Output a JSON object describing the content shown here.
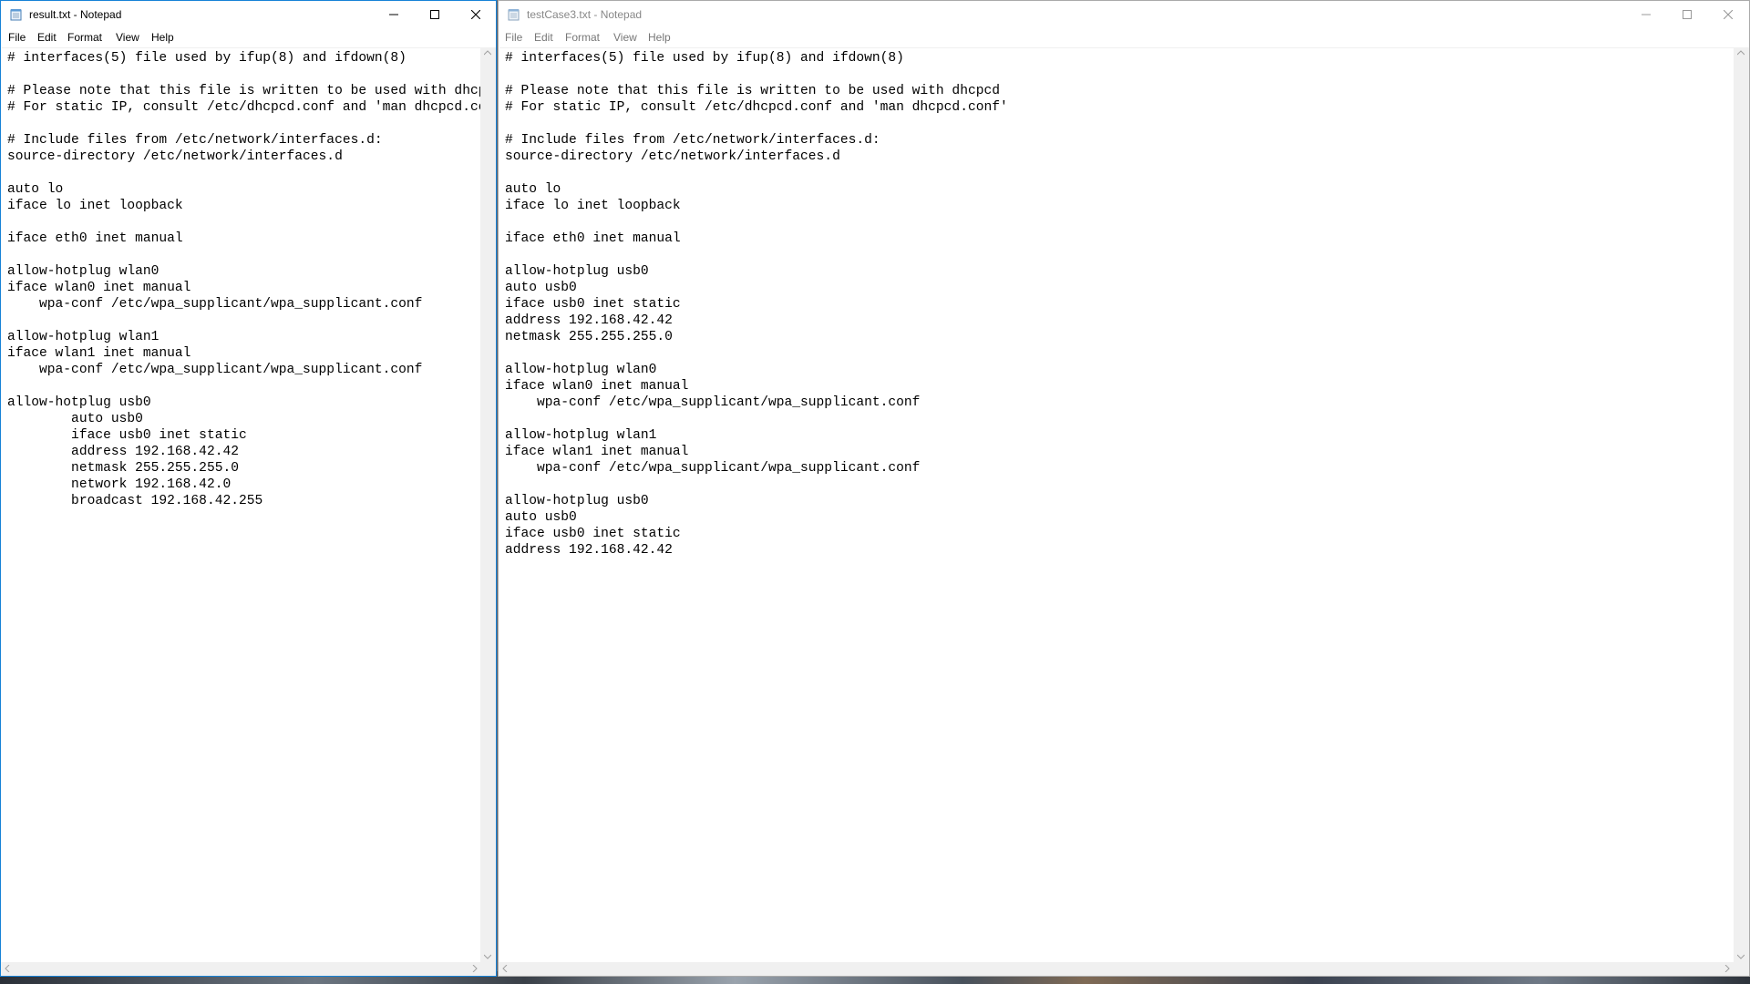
{
  "left_window": {
    "title": "result.txt - Notepad",
    "active": true,
    "menu": [
      "File",
      "Edit",
      "Format",
      "View",
      "Help"
    ],
    "content": "# interfaces(5) file used by ifup(8) and ifdown(8)\n\n# Please note that this file is written to be used with dhcpcd\n# For static IP, consult /etc/dhcpcd.conf and 'man dhcpcd.conf'\n\n# Include files from /etc/network/interfaces.d:\nsource-directory /etc/network/interfaces.d\n\nauto lo\niface lo inet loopback\n\niface eth0 inet manual\n\nallow-hotplug wlan0\niface wlan0 inet manual\n    wpa-conf /etc/wpa_supplicant/wpa_supplicant.conf\n\nallow-hotplug wlan1\niface wlan1 inet manual\n    wpa-conf /etc/wpa_supplicant/wpa_supplicant.conf\n\nallow-hotplug usb0\n        auto usb0\n        iface usb0 inet static\n        address 192.168.42.42\n        netmask 255.255.255.0\n        network 192.168.42.0\n        broadcast 192.168.42.255"
  },
  "right_window": {
    "title": "testCase3.txt - Notepad",
    "active": false,
    "menu": [
      "File",
      "Edit",
      "Format",
      "View",
      "Help"
    ],
    "content": "# interfaces(5) file used by ifup(8) and ifdown(8)\n\n# Please note that this file is written to be used with dhcpcd\n# For static IP, consult /etc/dhcpcd.conf and 'man dhcpcd.conf'\n\n# Include files from /etc/network/interfaces.d:\nsource-directory /etc/network/interfaces.d\n\nauto lo\niface lo inet loopback\n\niface eth0 inet manual\n\nallow-hotplug usb0\nauto usb0\niface usb0 inet static\naddress 192.168.42.42\nnetmask 255.255.255.0\n\nallow-hotplug wlan0\niface wlan0 inet manual\n    wpa-conf /etc/wpa_supplicant/wpa_supplicant.conf\n\nallow-hotplug wlan1\niface wlan1 inet manual\n    wpa-conf /etc/wpa_supplicant/wpa_supplicant.conf\n\nallow-hotplug usb0\nauto usb0\niface usb0 inet static\naddress 192.168.42.42"
  },
  "icons": {
    "app": "notepad-icon",
    "minimize": "minimize-icon",
    "maximize": "maximize-icon",
    "close": "close-icon"
  },
  "colors": {
    "active_border": "#1883d7",
    "inactive_border": "#aaaaaa",
    "scrollbar": "#f0f0f0"
  }
}
